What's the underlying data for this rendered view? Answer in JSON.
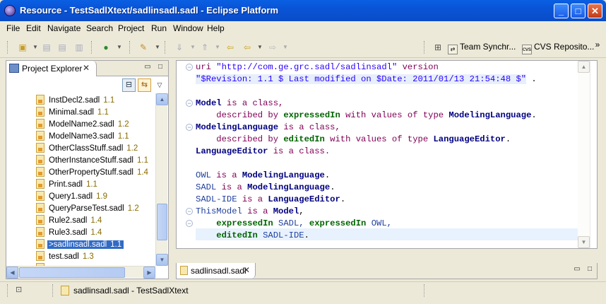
{
  "window": {
    "title": "Resource - TestSadlXtext/sadlinsadl.sadl - Eclipse Platform",
    "minimize": "_",
    "maximize": "□",
    "close": "✕"
  },
  "menu": [
    "File",
    "Edit",
    "Navigate",
    "Search",
    "Project",
    "Run",
    "Window",
    "Help"
  ],
  "toolbar": {
    "perspectives": [
      "Team Synchr...",
      "CVS Reposito..."
    ],
    "overflow": "»"
  },
  "explorer": {
    "tab_label": "Project Explorer",
    "close": "✕",
    "items": [
      {
        "name": "InstDecl2.sadl",
        "rev": "1.1"
      },
      {
        "name": "Minimal.sadl",
        "rev": "1.1"
      },
      {
        "name": "ModelName2.sadl",
        "rev": "1.2"
      },
      {
        "name": "ModelName3.sadl",
        "rev": "1.1"
      },
      {
        "name": "OtherClassStuff.sadl",
        "rev": "1.2"
      },
      {
        "name": "OtherInstanceStuff.sadl",
        "rev": "1.1"
      },
      {
        "name": "OtherPropertyStuff.sadl",
        "rev": "1.4"
      },
      {
        "name": "Print.sadl",
        "rev": "1.1"
      },
      {
        "name": "Query1.sadl",
        "rev": "1.9"
      },
      {
        "name": "QueryParseTest.sadl",
        "rev": "1.2"
      },
      {
        "name": "Rule2.sadl",
        "rev": "1.4"
      },
      {
        "name": "Rule3.sadl",
        "rev": "1.4"
      },
      {
        "name": ">sadlinsadl.sadl",
        "rev": "1.1"
      },
      {
        "name": "test.sadl",
        "rev": "1.3"
      }
    ]
  },
  "editor": {
    "tab_label": "sadlinsadl.sadl",
    "close": "✕",
    "code": {
      "l1": {
        "uri": "uri",
        "str": "\"http://com.ge.grc.sadl/sadlinsadl\"",
        "version": "version"
      },
      "l2": {
        "str": "\"$Revision: 1.1 $ Last modified on $Date: 2011/01/13 21:54:48 $\"",
        "end": " ."
      },
      "l3": {
        "a": "Model",
        "b": " is a class,"
      },
      "l4": {
        "a": "    described by ",
        "b": "expressedIn",
        "c": " with values of type ",
        "d": "ModelingLanguage",
        "e": "."
      },
      "l5": {
        "a": "ModelingLanguage",
        "b": " is a class,"
      },
      "l6": {
        "a": "    described by ",
        "b": "editedIn",
        "c": " with values of type ",
        "d": "LanguageEditor",
        "e": "."
      },
      "l7": {
        "a": "LanguageEditor",
        "b": " is a class."
      },
      "l8": {
        "a": "OWL",
        "b": " is a ",
        "c": "ModelingLanguage",
        "d": "."
      },
      "l9": {
        "a": "SADL",
        "b": " is a ",
        "c": "ModelingLanguage",
        "d": "."
      },
      "l10": {
        "a": "SADL-IDE",
        "b": " is a ",
        "c": "LanguageEditor",
        "d": "."
      },
      "l11": {
        "a": "ThisModel",
        "b": " is a ",
        "c": "Model",
        "d": ","
      },
      "l12": {
        "a": "    ",
        "b": "expressedIn",
        "c": " SADL, ",
        "d": "expressedIn",
        "e": " OWL,"
      },
      "l13": {
        "a": "    ",
        "b": "editedIn",
        "c": " SADL-IDE",
        "d": "."
      }
    }
  },
  "status": {
    "message": "sadlinsadl.sadl - TestSadlXtext"
  }
}
